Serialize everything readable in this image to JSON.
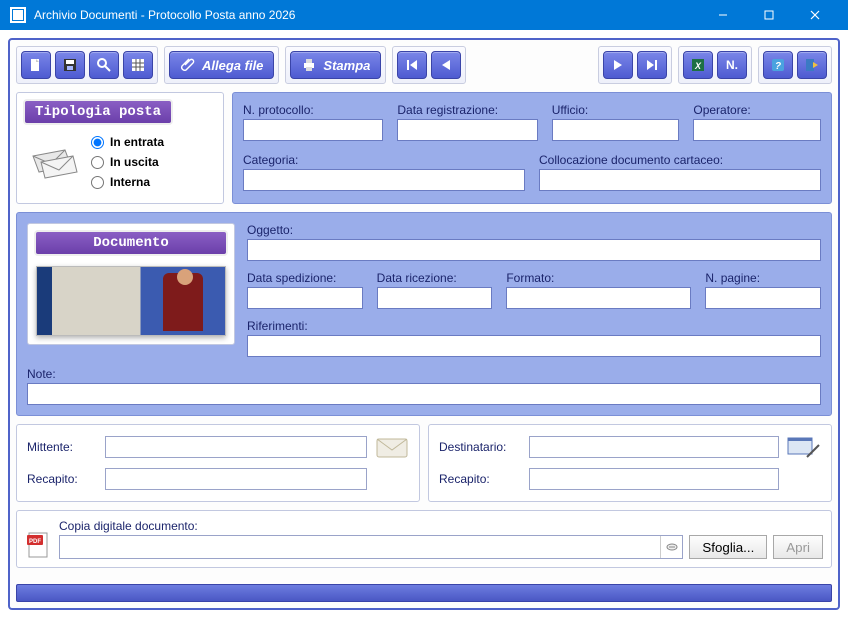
{
  "window": {
    "title": "Archivio Documenti - Protocollo Posta anno 2026"
  },
  "toolbar": {
    "allega_label": "Allega file",
    "stampa_label": "Stampa"
  },
  "tipologia": {
    "header": "Tipologia posta",
    "options": {
      "in_entrata": "In entrata",
      "in_uscita": "In uscita",
      "interna": "Interna"
    },
    "selected": "in_entrata"
  },
  "protocollo": {
    "n_protocollo_label": "N. protocollo:",
    "n_protocollo": "",
    "data_reg_label": "Data registrazione:",
    "data_reg": "",
    "ufficio_label": "Ufficio:",
    "ufficio": "",
    "operatore_label": "Operatore:",
    "operatore": "",
    "categoria_label": "Categoria:",
    "categoria": "",
    "collocazione_label": "Collocazione documento cartaceo:",
    "collocazione": ""
  },
  "documento": {
    "header": "Documento",
    "oggetto_label": "Oggetto:",
    "oggetto": "",
    "data_sped_label": "Data spedizione:",
    "data_sped": "",
    "data_ric_label": "Data ricezione:",
    "data_ric": "",
    "formato_label": "Formato:",
    "formato": "",
    "n_pagine_label": "N. pagine:",
    "n_pagine": "",
    "riferimenti_label": "Riferimenti:",
    "riferimenti": "",
    "note_label": "Note:",
    "note": ""
  },
  "mittente": {
    "mittente_label": "Mittente:",
    "mittente": "",
    "recapito_label": "Recapito:",
    "recapito": ""
  },
  "destinatario": {
    "dest_label": "Destinatario:",
    "dest": "",
    "recapito_label": "Recapito:",
    "recapito": ""
  },
  "copia": {
    "label": "Copia digitale documento:",
    "path": "",
    "sfoglia": "Sfoglia...",
    "apri": "Apri"
  }
}
